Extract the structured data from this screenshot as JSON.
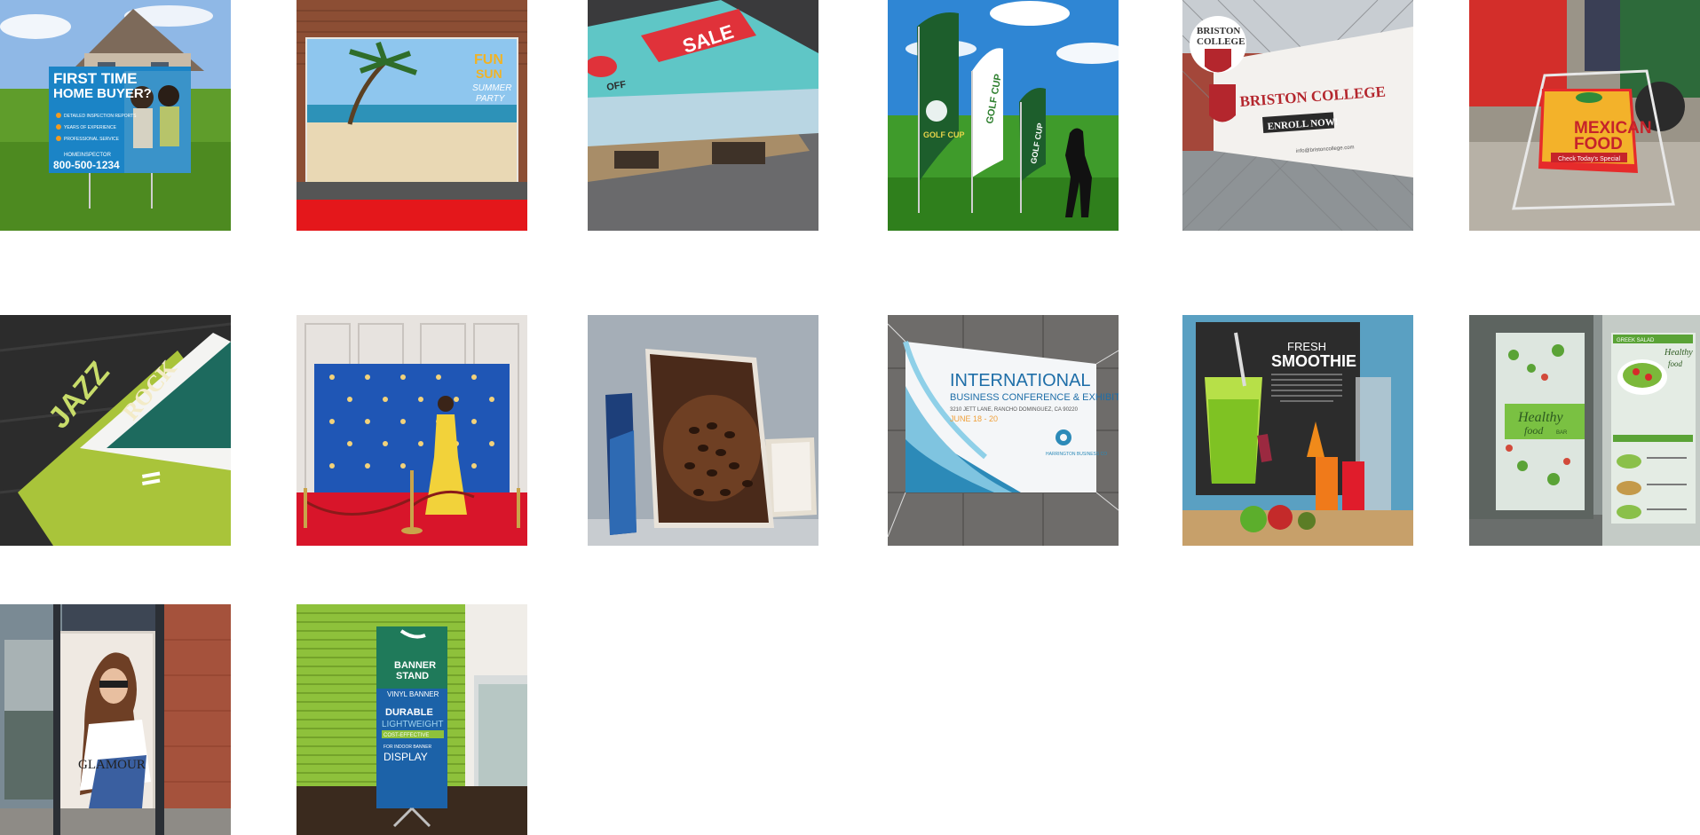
{
  "gallery": {
    "tiles": [
      {
        "lines": [
          "FIRST TIME",
          "HOME BUYER?",
          "DETAILED INSPECTION REPORTS",
          "YEARS OF EXPERIENCE",
          "PROFESSIONAL SERVICE",
          "HOMEINSPECTOR",
          "800-500-1234"
        ]
      },
      {
        "lines": [
          "FUN",
          "SUN",
          "SUMMER",
          "PARTY"
        ]
      },
      {
        "lines": [
          "SALE",
          "OFF"
        ]
      },
      {
        "lines": [
          "GOLF CUP",
          "GOLF CUP",
          "GOLF CUP"
        ]
      },
      {
        "lines": [
          "BRISTON",
          "COLLEGE",
          "BRISTON COLLEGE",
          "ENROLL NOW!",
          "info@bristoncollege.com"
        ]
      },
      {
        "lines": [
          "MEXICAN",
          "FOOD",
          "Check Today's Special"
        ]
      },
      {
        "lines": [
          "JAZZ",
          "ROCK"
        ]
      },
      {
        "lines": []
      },
      {
        "lines": []
      },
      {
        "lines": [
          "INTERNATIONAL",
          "BUSINESS CONFERENCE & EXHIBIT",
          "3210 JETT LANE, RANCHO DOMINGUEZ, CA 90220",
          "JUNE 18 - 20",
          "HARRINGTON BUSINESS CO"
        ]
      },
      {
        "lines": [
          "FRESH",
          "SMOOTHIE"
        ]
      },
      {
        "lines": [
          "Healthy",
          "food",
          "BAR",
          "GREEK SALAD",
          "Healthy",
          "food"
        ]
      },
      {
        "lines": [
          "GLAMOUR"
        ]
      },
      {
        "lines": [
          "BANNER",
          "STAND",
          "VINYL BANNER",
          "DURABLE",
          "LIGHTWEIGHT",
          "COST-EFFECTIVE",
          "FOR INDOOR BANNER",
          "DISPLAY"
        ]
      }
    ]
  }
}
